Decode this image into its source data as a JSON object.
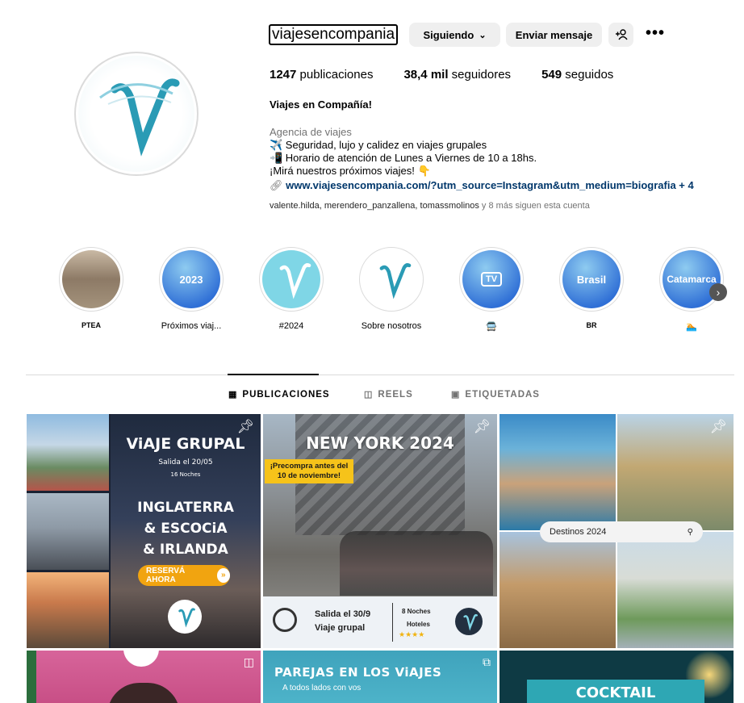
{
  "profile": {
    "username": "viajesencompania",
    "follow_label": "Siguiendo",
    "message_label": "Enviar mensaje",
    "posts_count": "1247",
    "posts_label": "publicaciones",
    "followers_count": "38,4 mil",
    "followers_label": "seguidores",
    "following_count": "549",
    "following_label": "seguidos"
  },
  "bio": {
    "name": "Viajes en Compañía!",
    "category": "Agencia de viajes",
    "line1": "✈️ Seguridad, lujo y calidez en viajes grupales",
    "line2": "📲 Horario de atención de Lunes a Viernes de 10 a 18hs.",
    "line3": "¡Mirá nuestros próximos viajes! 👇",
    "link": "www.viajesencompania.com/?utm_source=Instagram&utm_medium=biografia + 4"
  },
  "followed_by": {
    "users": "valente.hilda, merendero_panzallena, tomassmolinos",
    "more": " y 8 más siguen esta cuenta"
  },
  "highlights": [
    {
      "label": "PTEA",
      "text": ""
    },
    {
      "label": "Próximos viaj...",
      "text": "2023"
    },
    {
      "label": "#2024",
      "text": ""
    },
    {
      "label": "Sobre nosotros",
      "text": ""
    },
    {
      "label": "🚍",
      "text": "TV"
    },
    {
      "label": "BR",
      "text": "Brasil"
    },
    {
      "label": "🏊",
      "text": "Catamarca"
    }
  ],
  "tabs": {
    "posts": "PUBLICACIONES",
    "reels": "REELS",
    "tagged": "ETIQUETADAS"
  },
  "posts": {
    "p1_title": "ViAJE GRUPAL",
    "p1_date": "Salida el 20/05",
    "p1_nights": "16 Noches",
    "p1_dest1": "INGLATERRA",
    "p1_dest2": "& ESCOCiA",
    "p1_dest3": "& IRLANDA",
    "p1_cta": "RESERVÁ AHORA",
    "p2_title": "NEW YORK 2024",
    "p2_badge1": "¡Precompra antes del",
    "p2_badge2": "10 de noviembre!",
    "p2_exit1": "Salida el 30/9",
    "p2_exit2": "Viaje grupal",
    "p2_nights1": "8 Noches",
    "p2_nights2": "Hoteles",
    "p3_search": "Destinos 2024",
    "p4_title": "PAREJAS EN LOS ViAJES",
    "p4_sub": "A todos lados con vos",
    "p5_title": "COCKTAIL"
  },
  "colors": {
    "accent_link": "#00376b",
    "button_bg": "#efefef",
    "secondary_text": "#737373",
    "brand_teal": "#2a9bb5"
  }
}
